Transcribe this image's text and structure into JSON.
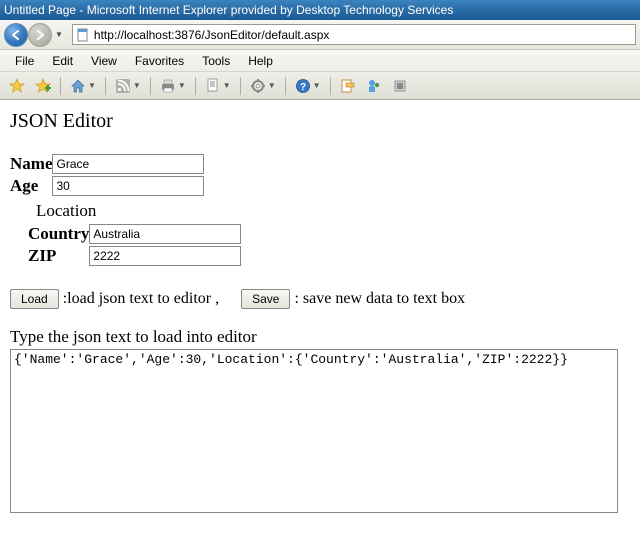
{
  "window": {
    "title": "Untitled Page - Microsoft Internet Explorer provided by Desktop Technology Services"
  },
  "address": {
    "url": "http://localhost:3876/JsonEditor/default.aspx"
  },
  "menubar": {
    "items": [
      "File",
      "Edit",
      "View",
      "Favorites",
      "Tools",
      "Help"
    ]
  },
  "page": {
    "heading": "JSON Editor",
    "fields": {
      "name_label": "Name",
      "name_value": "Grace",
      "age_label": "Age",
      "age_value": "30",
      "location_heading": "Location",
      "country_label": "Country",
      "country_value": "Australia",
      "zip_label": "ZIP",
      "zip_value": "2222"
    },
    "buttons": {
      "load_label": "Load",
      "load_desc": ":load json text to editor ,",
      "save_label": "Save",
      "save_desc": ": save new data to text box"
    },
    "textarea": {
      "label": "Type the json text to load into editor",
      "value": "{'Name':'Grace','Age':30,'Location':{'Country':'Australia','ZIP':2222}}"
    }
  }
}
